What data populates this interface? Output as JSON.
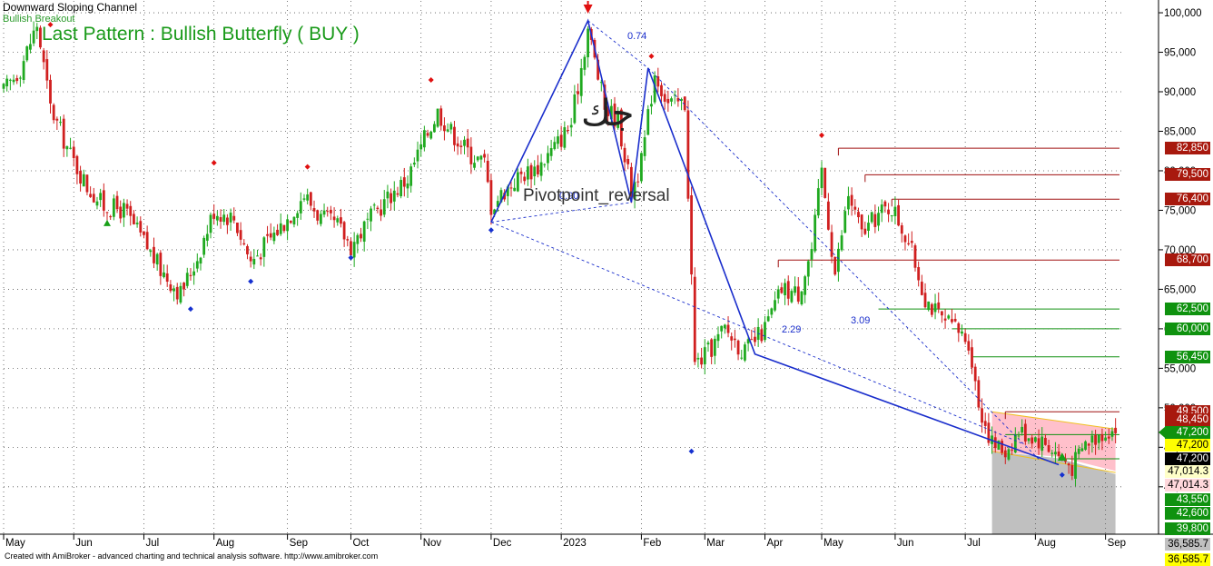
{
  "header": {
    "title": "Downward Sloping Channel",
    "subtitle": "Bullish Breakout",
    "logo_icon": "jk-logo-icon"
  },
  "annotations": {
    "pattern": "Last Pattern : Bullish Butterfly ( BUY )",
    "pivot": "Pivotpoint_reversal",
    "ratio_1": "0.74",
    "ratio_2": "2.29",
    "ratio_3": "3.09",
    "ratio_hidden": "0.90"
  },
  "footer": "Created with AmiBroker - advanced charting and technical analysis software. http://www.amibroker.com",
  "colors": {
    "up": "#1fa91f",
    "down": "#d01f1f",
    "pattern": "#1a2ecc",
    "resistance": "#a01010",
    "support": "#119011",
    "channel_fill": "#ffc0cb",
    "gray_fill": "#c0c0c0"
  },
  "chart_data": {
    "type": "candlestick",
    "y_axis": {
      "ticks": [
        100000,
        95000,
        90000,
        85000,
        80000,
        75000,
        70000,
        65000,
        60000,
        55000,
        50000,
        45000,
        40000
      ],
      "tick_labels": [
        "100,000",
        "95,000",
        "90,000",
        "85,000",
        "80,000",
        "75,000",
        "70,000",
        "65,000",
        "60,000",
        "55,000",
        "50,000",
        "45,000",
        "40,000"
      ],
      "ylim": [
        34000,
        101500
      ]
    },
    "x_axis": {
      "months": [
        {
          "label": "May",
          "x": 0
        },
        {
          "label": "Jun",
          "x": 21
        },
        {
          "label": "Jul",
          "x": 42
        },
        {
          "label": "Aug",
          "x": 63
        },
        {
          "label": "Sep",
          "x": 85
        },
        {
          "label": "Oct",
          "x": 104
        },
        {
          "label": "Nov",
          "x": 125
        },
        {
          "label": "Dec",
          "x": 146
        },
        {
          "label": "2023",
          "x": 167
        },
        {
          "label": "Feb",
          "x": 191
        },
        {
          "label": "Mar",
          "x": 210
        },
        {
          "label": "Apr",
          "x": 228
        },
        {
          "label": "May",
          "x": 245
        },
        {
          "label": "Jun",
          "x": 267
        },
        {
          "label": "Jul",
          "x": 288
        },
        {
          "label": "Aug",
          "x": 309
        },
        {
          "label": "Sep",
          "x": 330
        }
      ],
      "xlim": [
        0,
        335
      ]
    },
    "price_path": [
      [
        0,
        90000
      ],
      [
        5,
        93000
      ],
      [
        10,
        98500
      ],
      [
        14,
        88000
      ],
      [
        20,
        82000
      ],
      [
        25,
        78000
      ],
      [
        30,
        75500
      ],
      [
        36,
        75000
      ],
      [
        42,
        71000
      ],
      [
        47,
        67500
      ],
      [
        53,
        64500
      ],
      [
        58,
        69000
      ],
      [
        63,
        75000
      ],
      [
        69,
        74000
      ],
      [
        74,
        68500
      ],
      [
        79,
        71000
      ],
      [
        85,
        74000
      ],
      [
        90,
        77000
      ],
      [
        95,
        74000
      ],
      [
        100,
        73000
      ],
      [
        104,
        70500
      ],
      [
        110,
        74000
      ],
      [
        116,
        77000
      ],
      [
        121,
        79000
      ],
      [
        126,
        84000
      ],
      [
        130,
        87500
      ],
      [
        134,
        85000
      ],
      [
        140,
        82000
      ],
      [
        144,
        81000
      ],
      [
        146,
        75500
      ],
      [
        150,
        77500
      ],
      [
        155,
        79500
      ],
      [
        160,
        80500
      ],
      [
        165,
        83000
      ],
      [
        170,
        86000
      ],
      [
        175,
        98000
      ],
      [
        180,
        88000
      ],
      [
        184,
        86500
      ],
      [
        188,
        77500
      ],
      [
        191,
        81000
      ],
      [
        195,
        92500
      ],
      [
        199,
        88500
      ],
      [
        204,
        88500
      ],
      [
        207,
        55500
      ],
      [
        211,
        57000
      ],
      [
        216,
        60000
      ],
      [
        222,
        57000
      ],
      [
        228,
        60000
      ],
      [
        233,
        65000
      ],
      [
        238,
        64500
      ],
      [
        242,
        70000
      ],
      [
        245,
        80000
      ],
      [
        249,
        67000
      ],
      [
        253,
        77000
      ],
      [
        257,
        72000
      ],
      [
        262,
        74500
      ],
      [
        266,
        75500
      ],
      [
        271,
        71000
      ],
      [
        276,
        64000
      ],
      [
        281,
        61000
      ],
      [
        285,
        60000
      ],
      [
        289,
        58500
      ],
      [
        292,
        50500
      ],
      [
        296,
        45500
      ],
      [
        300,
        44500
      ],
      [
        304,
        47000
      ],
      [
        308,
        46500
      ],
      [
        312,
        45500
      ],
      [
        316,
        44000
      ],
      [
        320,
        42500
      ],
      [
        324,
        45500
      ],
      [
        330,
        47200
      ],
      [
        333,
        47200
      ]
    ],
    "butterfly_pattern": [
      [
        146,
        73500
      ],
      [
        175,
        99000
      ],
      [
        188,
        76000
      ],
      [
        193,
        93000
      ],
      [
        225,
        56800
      ],
      [
        316,
        42800
      ]
    ],
    "pattern_dashed_lines": [
      [
        [
          146,
          73500
        ],
        [
          188,
          76000
        ]
      ],
      [
        [
          175,
          99000
        ],
        [
          193,
          93000
        ]
      ],
      [
        [
          146,
          73500
        ],
        [
          305,
          45500
        ]
      ],
      [
        [
          193,
          93000
        ],
        [
          310,
          43500
        ]
      ]
    ],
    "channel_polygon": [
      [
        296,
        49500
      ],
      [
        330,
        47500
      ],
      [
        333,
        47200
      ],
      [
        333,
        42000
      ],
      [
        316,
        43800
      ],
      [
        296,
        44500
      ]
    ],
    "support_area_polygon": [
      [
        296,
        44500
      ],
      [
        316,
        43600
      ],
      [
        333,
        41600
      ],
      [
        333,
        34000
      ],
      [
        296,
        34000
      ]
    ],
    "resistance_levels": [
      {
        "value": 82850,
        "x_start": 250
      },
      {
        "value": 79500,
        "x_start": 258
      },
      {
        "value": 76400,
        "x_start": 266
      },
      {
        "value": 68700,
        "x_start": 232
      },
      {
        "value": 49500,
        "x_start": 300
      }
    ],
    "support_levels": [
      {
        "value": 62500,
        "x_start": 262
      },
      {
        "value": 60000,
        "x_start": 284
      },
      {
        "value": 56450,
        "x_start": 290
      },
      {
        "value": 46600,
        "x_start": 300
      },
      {
        "value": 43550,
        "x_start": 318
      }
    ],
    "swing_high_markers": [
      [
        14,
        98500
      ],
      [
        63,
        81000
      ],
      [
        91,
        80500
      ],
      [
        128,
        91500
      ],
      [
        194,
        94500
      ],
      [
        245,
        84500
      ]
    ],
    "swing_low_markers": [
      [
        56,
        62500
      ],
      [
        74,
        66000
      ],
      [
        104,
        69000
      ],
      [
        146,
        72500
      ],
      [
        206,
        44500
      ],
      [
        317,
        41500
      ]
    ],
    "price_labels": [
      {
        "text": "82,850",
        "value": 82850,
        "style": "resistance"
      },
      {
        "text": "79,500",
        "value": 79500,
        "style": "resistance"
      },
      {
        "text": "76,400",
        "value": 76400,
        "style": "resistance"
      },
      {
        "text": "68,700",
        "value": 68700,
        "style": "resistance"
      },
      {
        "text": "62,500",
        "value": 62500,
        "style": "support"
      },
      {
        "text": "60,000",
        "value": 60000,
        "style": "support"
      },
      {
        "text": "56,450",
        "value": 56450,
        "style": "support"
      },
      {
        "text": "49,500",
        "value": 49500,
        "style": "resistance"
      },
      {
        "text": "48,450",
        "value": 48450,
        "style": "resistance"
      },
      {
        "text": "47,200",
        "value": 46900,
        "style": "last"
      },
      {
        "text": "47,200",
        "value": 45300,
        "style": "yellow"
      },
      {
        "text": "47,200",
        "value": 43600,
        "style": "black"
      },
      {
        "text": "47,014.3",
        "value": 41900,
        "style": "ywhite"
      },
      {
        "text": "47,014.3",
        "value": 40200,
        "style": "pinkbox"
      },
      {
        "text": "43,550",
        "value": 38400,
        "style": "support"
      },
      {
        "text": "42,600",
        "value": 36600,
        "style": "support"
      },
      {
        "text": "39,800",
        "value": 34700,
        "style": "support"
      },
      {
        "text": "36,585.7",
        "value": 32700,
        "style": "gray"
      },
      {
        "text": "36,585.7",
        "value": 30800,
        "style": "yellow"
      }
    ]
  }
}
